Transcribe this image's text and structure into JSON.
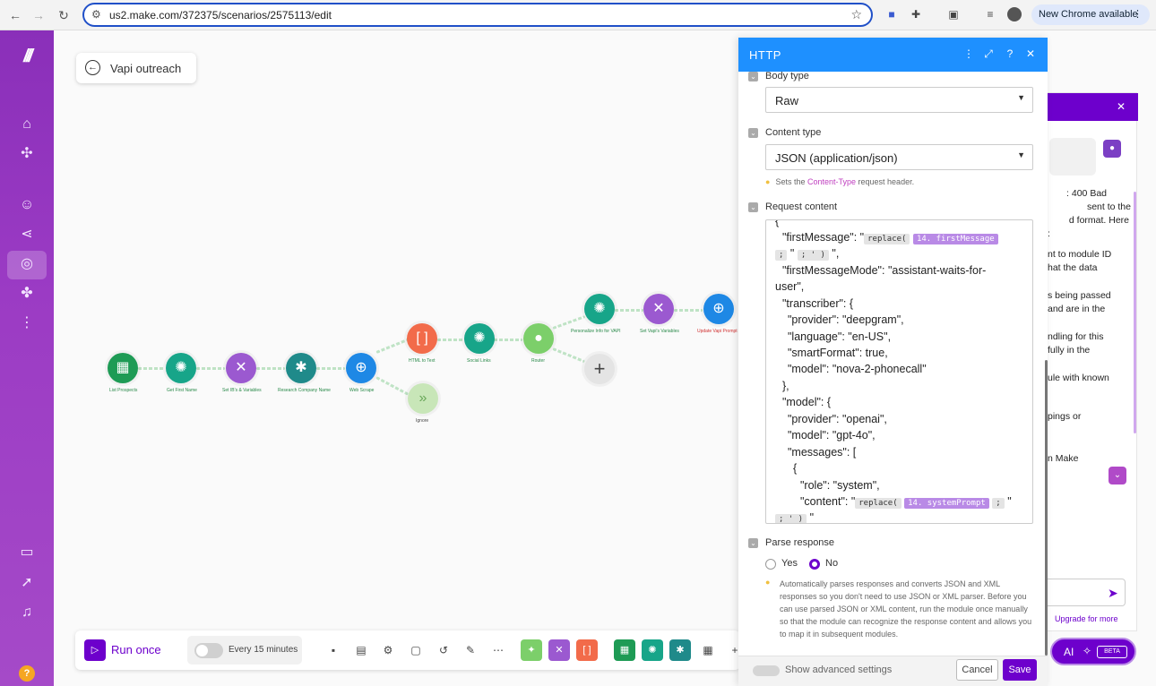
{
  "browser": {
    "url": "us2.make.com/372375/scenarios/2575113/edit",
    "new_chrome": "New Chrome available"
  },
  "scenario": {
    "name": "Vapi outreach"
  },
  "canvas": {
    "nodes": [
      {
        "label": "List Prospects",
        "color": "#1e9b55",
        "icon": "sheets-icon"
      },
      {
        "label": "Get First Name",
        "color": "#17a589",
        "icon": "openai-icon"
      },
      {
        "label": "Set IB's & Variables",
        "color": "#9b59d0",
        "icon": "tools-icon"
      },
      {
        "label": "Research Company Name",
        "color": "#1f8a8a",
        "icon": "bug-icon"
      },
      {
        "label": "Web Scrape",
        "color": "#1e88e5",
        "icon": "globe-icon"
      },
      {
        "label": "HTML to Text",
        "color": "#f26b4a",
        "icon": "bracket-icon"
      },
      {
        "label": "Social Links",
        "color": "#17a589",
        "icon": "openai-icon"
      },
      {
        "label": "Router",
        "color": "#7ccf6a",
        "icon": "router-icon"
      },
      {
        "label": "Personalize Info for VAPI",
        "color": "#17a589",
        "icon": "openai-icon"
      },
      {
        "label": "Set Vapi's Variables",
        "color": "#9b59d0",
        "icon": "tools-icon"
      },
      {
        "label": "Update Vapi Prompt",
        "color": "#1e88e5",
        "icon": "globe-icon"
      },
      {
        "label": "Ignore",
        "color": "#c8e6b8",
        "icon": "forward-icon"
      }
    ]
  },
  "toolbar": {
    "run_label": "Run once",
    "schedule_label": "Every 15 minutes"
  },
  "http_panel": {
    "title": "HTTP",
    "body_type_label": "Body type",
    "body_type_value": "Raw",
    "content_type_label": "Content type",
    "content_type_value": "JSON (application/json)",
    "content_type_hint_pre": "Sets the",
    "content_type_hint_pill": "Content-Type",
    "content_type_hint_post": "request header.",
    "request_content_label": "Request content",
    "code": {
      "l0": "{",
      "l1_key": "\"firstMessage\": \"",
      "fn_replace": "replace(",
      "var_first": "14. firstMessage",
      "l2_a": ";",
      "l2_b": "\"",
      "l2_c": "; ' )",
      "l2_d": "\",",
      "l3": "\"firstMessageMode\": \"assistant-waits-for-",
      "l4": "user\",",
      "l5": "\"transcriber\": {",
      "l6": "\"provider\": \"deepgram\",",
      "l7": "\"language\": \"en-US\",",
      "l8": "\"smartFormat\": true,",
      "l9": "\"model\": \"nova-2-phonecall\"",
      "l10": "},",
      "l11": "\"model\": {",
      "l12": "\"provider\": \"openai\",",
      "l13": "\"model\": \"gpt-4o\",",
      "l14": "\"messages\": [",
      "l15": "{",
      "l16": "\"role\": \"system\",",
      "l17_key": "\"content\": \"",
      "var_system": "14. systemPrompt",
      "l17_end": "; \"",
      "l18_a": "; ' )",
      "l18_b": "\""
    },
    "parse_response_label": "Parse response",
    "yes_label": "Yes",
    "no_label": "No",
    "parse_description": "Automatically parses responses and converts JSON and XML responses so you don't need to use JSON or XML parser. Before you can use parsed JSON or XML content, run the module once manually so that the module can recognize the response content and allows you to map it in subsequent modules.",
    "advanced_label": "Show advanced settings",
    "cancel_label": "Cancel",
    "save_label": "Save"
  },
  "ai_panel": {
    "lines": [
      ": 400 Bad",
      "sent to the",
      "d format. Here",
      ":",
      "nt to module ID",
      "hat the data",
      "s being passed",
      "and are in the",
      "ndling for this",
      "fully in the",
      "ule with known",
      "pings or",
      "n Make"
    ],
    "upgrade": "Upgrade for more",
    "button_label": "AI",
    "beta": "BETA"
  }
}
